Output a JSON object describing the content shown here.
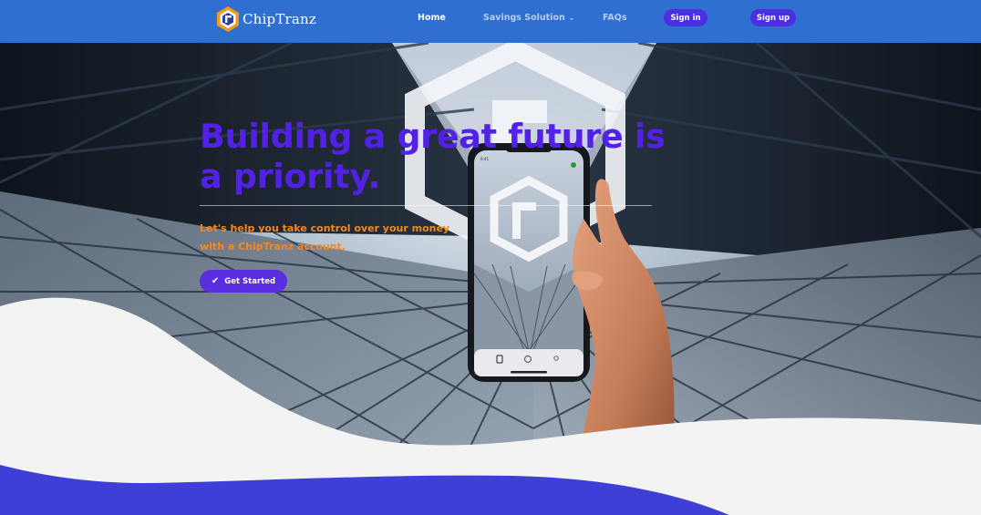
{
  "brand": {
    "name": "ChipTranz",
    "logo_icon": "hexagon-ct-logo-icon",
    "colors": {
      "nav": "#2f6fcf",
      "accent": "#5321e6",
      "button": "#4b2fe0",
      "subtext": "#f08a1f",
      "wave": "#3d3fd6"
    }
  },
  "nav": {
    "home": "Home",
    "savings": "Savings Solution",
    "savings_icon": "chevron-down-icon",
    "faqs": "FAQs",
    "signin": "Sign in",
    "signup": "Sign up"
  },
  "hero": {
    "headline": "Building a great future is a priority.",
    "subtext": "Let's help you take control over your money with a ChipTranz account.",
    "cta_label": "Get Started",
    "cta_icon": "check-icon"
  }
}
